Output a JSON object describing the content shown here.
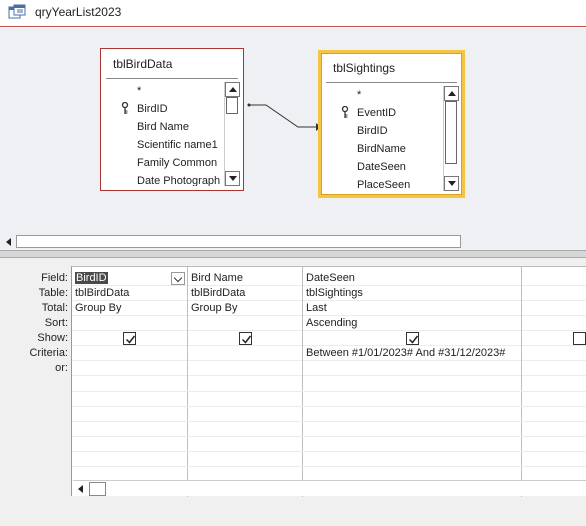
{
  "query": {
    "title": "qryYearList2023",
    "icon": "query-icon"
  },
  "tables": [
    {
      "name": "tblBirdData",
      "fields": [
        "*",
        "BirdID",
        "Bird Name",
        "Scientific name1",
        "Family Common N",
        "Date Photograph"
      ],
      "key_field": "BirdID"
    },
    {
      "name": "tblSightings",
      "fields": [
        "*",
        "EventID",
        "BirdID",
        "BirdName",
        "DateSeen",
        "PlaceSeen"
      ],
      "key_field": "EventID"
    }
  ],
  "row_labels": [
    "Field:",
    "Table:",
    "Total:",
    "Sort:",
    "Show:",
    "Criteria:",
    "or:"
  ],
  "columns": [
    {
      "field": "BirdID",
      "table": "tblBirdData",
      "total": "Group By",
      "sort": "",
      "show": true,
      "criteria": "",
      "or": ""
    },
    {
      "field": "Bird Name",
      "table": "tblBirdData",
      "total": "Group By",
      "sort": "",
      "show": true,
      "criteria": "",
      "or": ""
    },
    {
      "field": "DateSeen",
      "table": "tblSightings",
      "total": "Last",
      "sort": "Ascending",
      "show": true,
      "criteria": "Between #1/01/2023# And #31/12/2023#",
      "or": ""
    },
    {
      "field": "",
      "table": "",
      "total": "",
      "sort": "",
      "show": false,
      "criteria": "",
      "or": ""
    }
  ],
  "colors": {
    "selected_table_border": "#f5c542",
    "table_border": "#aa3333",
    "tab_accent": "#c0504d",
    "design_bg": "#eef0f3"
  }
}
